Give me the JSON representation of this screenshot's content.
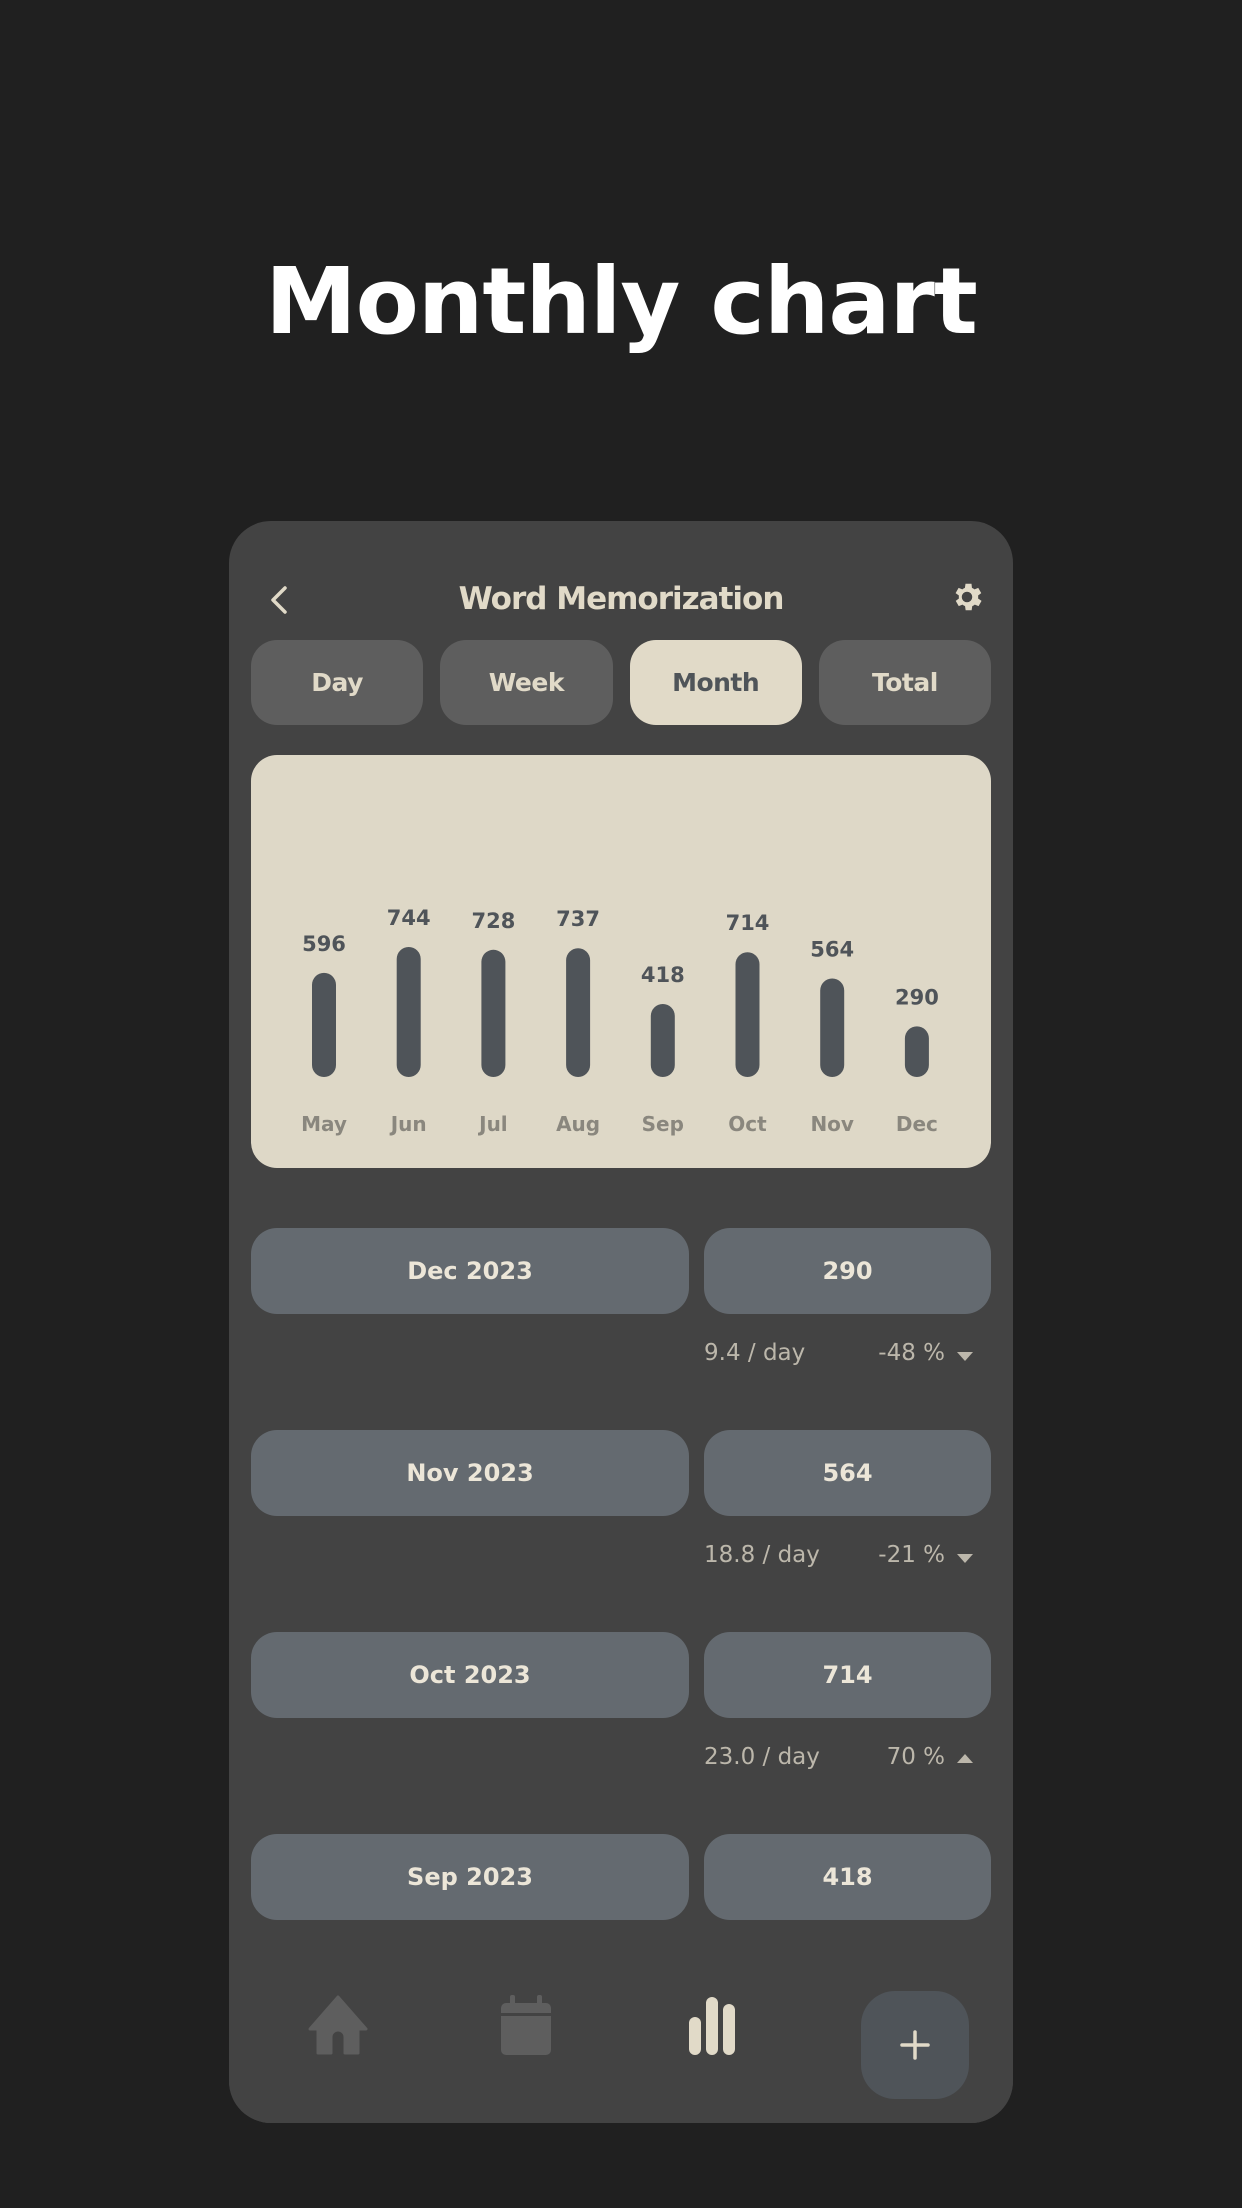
{
  "hero": {
    "title": "Monthly chart"
  },
  "header": {
    "title": "Word Memorization",
    "back_icon": "chevron-left-icon",
    "settings_icon": "gear-icon"
  },
  "tabs": [
    {
      "label": "Day",
      "active": false
    },
    {
      "label": "Week",
      "active": false
    },
    {
      "label": "Month",
      "active": true
    },
    {
      "label": "Total",
      "active": false
    }
  ],
  "colors": {
    "background": "#202020",
    "panel": "#434343",
    "accent": "#e1dac8",
    "bar": "#4f5459",
    "pill": "#646a70"
  },
  "chart_data": {
    "type": "bar",
    "categories": [
      "May",
      "Jun",
      "Jul",
      "Aug",
      "Sep",
      "Oct",
      "Nov",
      "Dec"
    ],
    "values": [
      596,
      744,
      728,
      737,
      418,
      714,
      564,
      290
    ],
    "title": "",
    "xlabel": "",
    "ylabel": "",
    "ylim": [
      0,
      744
    ],
    "grid": false,
    "data_labels": true
  },
  "rows": [
    {
      "month": "Dec 2023",
      "count": "290",
      "per_day": "9.4  / day",
      "change": "-48 %",
      "direction": "down"
    },
    {
      "month": "Nov 2023",
      "count": "564",
      "per_day": "18.8  / day",
      "change": "-21 %",
      "direction": "down"
    },
    {
      "month": "Oct 2023",
      "count": "714",
      "per_day": "23.0  / day",
      "change": "70 %",
      "direction": "up"
    },
    {
      "month": "Sep 2023",
      "count": "418",
      "per_day": "",
      "change": "",
      "direction": ""
    }
  ],
  "nav": {
    "items": [
      {
        "icon": "home-icon",
        "active": false
      },
      {
        "icon": "calendar-icon",
        "active": false
      },
      {
        "icon": "bar-chart-icon",
        "active": true
      }
    ],
    "fab_icon": "plus-icon"
  }
}
